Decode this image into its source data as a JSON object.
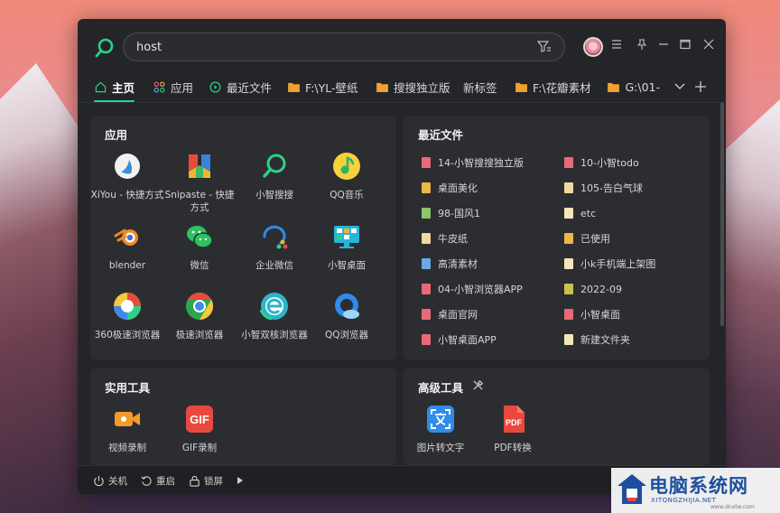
{
  "search": {
    "value": "host",
    "placeholder": ""
  },
  "tabs": [
    {
      "label": "主页",
      "icon": "home-icon",
      "active": true
    },
    {
      "label": "应用",
      "icon": "apps-grid-icon"
    },
    {
      "label": "最近文件",
      "icon": "recent-clock-icon"
    },
    {
      "label": "F:\\YL-壁纸",
      "icon": "folder-icon"
    },
    {
      "label": "搜搜独立版",
      "icon": "folder-icon"
    },
    {
      "label": "新标签",
      "icon": ""
    },
    {
      "label": "F:\\花瓣素材",
      "icon": "folder-icon"
    },
    {
      "label": "G:\\01-",
      "icon": "folder-icon"
    }
  ],
  "apps_panel": {
    "title": "应用",
    "apps": [
      {
        "label": "XiYou - 快捷方式",
        "icon": "xiyou-icon"
      },
      {
        "label": "Snipaste - 快捷方式",
        "icon": "snipaste-icon"
      },
      {
        "label": "小智搜搜",
        "icon": "xiaozhi-search-icon"
      },
      {
        "label": "QQ音乐",
        "icon": "qq-music-icon"
      },
      {
        "label": "blender",
        "icon": "blender-icon"
      },
      {
        "label": "微信",
        "icon": "wechat-icon"
      },
      {
        "label": "企业微信",
        "icon": "wecom-icon"
      },
      {
        "label": "小智桌面",
        "icon": "xiaozhi-desktop-icon"
      },
      {
        "label": "360极速浏览器",
        "icon": "360-browser-icon"
      },
      {
        "label": "极速浏览器",
        "icon": "chrome-icon"
      },
      {
        "label": "小智双核浏览器",
        "icon": "xiaozhi-browser-icon"
      },
      {
        "label": "QQ浏览器",
        "icon": "qq-browser-icon"
      }
    ]
  },
  "recent_panel": {
    "title": "最近文件",
    "files": [
      {
        "label": "14-小智搜搜独立版",
        "color": "#e86a7a"
      },
      {
        "label": "10-小智todo",
        "color": "#e86a7a"
      },
      {
        "label": "桌面美化",
        "color": "#e8b84a"
      },
      {
        "label": "105-告白气球",
        "color": "#f0d9a0"
      },
      {
        "label": "98-国风1",
        "color": "#8fc46a"
      },
      {
        "label": "etc",
        "color": "#f3e6b8"
      },
      {
        "label": "牛皮纸",
        "color": "#f0d9a0"
      },
      {
        "label": "已使用",
        "color": "#e8b84a"
      },
      {
        "label": "高清素材",
        "color": "#6aa8e8"
      },
      {
        "label": "小k手机端上架图",
        "color": "#f3e6b8"
      },
      {
        "label": "04-小智浏览器APP",
        "color": "#e86a7a"
      },
      {
        "label": "2022-09",
        "color": "#c9c24a"
      },
      {
        "label": "桌面官网",
        "color": "#e86a7a"
      },
      {
        "label": "小智桌面",
        "color": "#e86a7a"
      },
      {
        "label": "小智桌面APP",
        "color": "#e86a7a"
      },
      {
        "label": "新建文件夹",
        "color": "#f3e6b8"
      }
    ]
  },
  "tools_panel": {
    "title": "实用工具",
    "tools": [
      {
        "label": "视频录制",
        "icon": "video-record-icon"
      },
      {
        "label": "GIF录制",
        "icon": "gif-record-icon"
      }
    ]
  },
  "advanced_panel": {
    "title": "高级工具",
    "tools": [
      {
        "label": "图片转文字",
        "icon": "ocr-icon"
      },
      {
        "label": "PDF转换",
        "icon": "pdf-convert-icon"
      }
    ]
  },
  "bottom_bar": {
    "shutdown": "关机",
    "restart": "重启",
    "lock": "锁屏"
  },
  "watermark": {
    "main": "电脑系统网",
    "sub": "XITONGZHIJIA.NET",
    "sub2": "www.dnxtw.com"
  },
  "colors": {
    "accent": "#2bd18a",
    "window_bg": "#242528",
    "panel_bg": "#2c2d31"
  }
}
